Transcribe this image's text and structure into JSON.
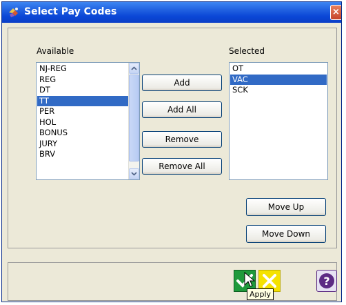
{
  "window": {
    "title": "Select Pay Codes",
    "close_symbol": "×"
  },
  "available": {
    "label": "Available",
    "items": [
      {
        "label": "NJ-REG",
        "selected": false
      },
      {
        "label": "REG",
        "selected": false
      },
      {
        "label": "DT",
        "selected": false
      },
      {
        "label": "TT",
        "selected": true
      },
      {
        "label": "PER",
        "selected": false
      },
      {
        "label": "HOL",
        "selected": false
      },
      {
        "label": "BONUS",
        "selected": false
      },
      {
        "label": "JURY",
        "selected": false
      },
      {
        "label": "BRV",
        "selected": false
      }
    ]
  },
  "selected": {
    "label": "Selected",
    "items": [
      {
        "label": "OT",
        "selected": false
      },
      {
        "label": "VAC",
        "selected": true
      },
      {
        "label": "SCK",
        "selected": false
      }
    ]
  },
  "buttons": {
    "add": "Add",
    "add_all": "Add All",
    "remove": "Remove",
    "remove_all": "Remove All",
    "move_up": "Move Up",
    "move_down": "Move Down"
  },
  "toolbar": {
    "apply_icon": "apply-check-icon",
    "cancel_icon": "cancel-x-icon",
    "help_icon": "help-icon",
    "tooltip": "Apply"
  },
  "colors": {
    "titlebar": "#0a46d6",
    "selection": "#316ac5",
    "apply_green": "#1f9a3c",
    "cancel_yellow": "#f5e200",
    "help_purple": "#5c2b84"
  }
}
